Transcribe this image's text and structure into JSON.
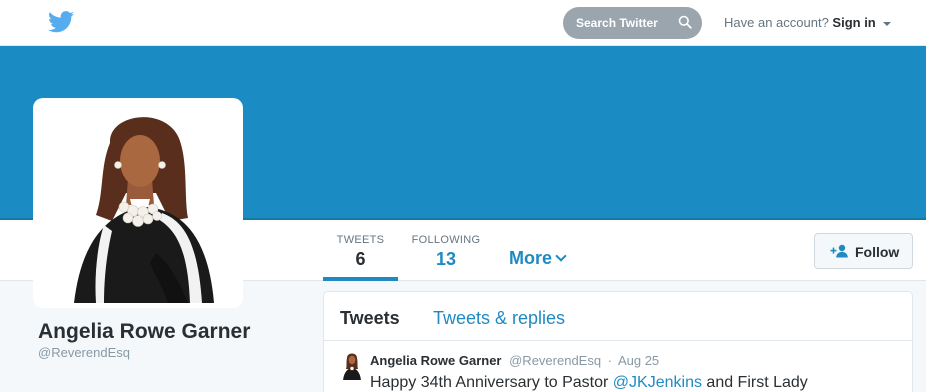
{
  "header": {
    "logo_icon": "twitter-bird-icon",
    "search_placeholder": "Search Twitter",
    "account_prompt": "Have an account?",
    "signin_label": "Sign in"
  },
  "colors": {
    "brand_blue": "#1b8cc3",
    "link_blue": "#1f8ac2",
    "text_dark": "#292f33",
    "text_muted": "#8899a6"
  },
  "profile": {
    "name": "Angelia Rowe Garner",
    "handle": "@ReverendEsq"
  },
  "nav": {
    "tweets_label": "TWEETS",
    "tweets_count": "6",
    "following_label": "FOLLOWING",
    "following_count": "13",
    "more_label": "More"
  },
  "follow_button": {
    "label": "Follow",
    "icon": "add-user-icon"
  },
  "timeline": {
    "tabs": [
      {
        "label": "Tweets",
        "active": true
      },
      {
        "label": "Tweets & replies",
        "active": false
      }
    ],
    "tweets": [
      {
        "name": "Angelia Rowe Garner",
        "handle": "@ReverendEsq",
        "separator": "·",
        "time": "Aug 25",
        "text_before": "Happy 34th Anniversary to Pastor ",
        "mention": "@JKJenkins",
        "text_after": " and First Lady"
      }
    ]
  }
}
